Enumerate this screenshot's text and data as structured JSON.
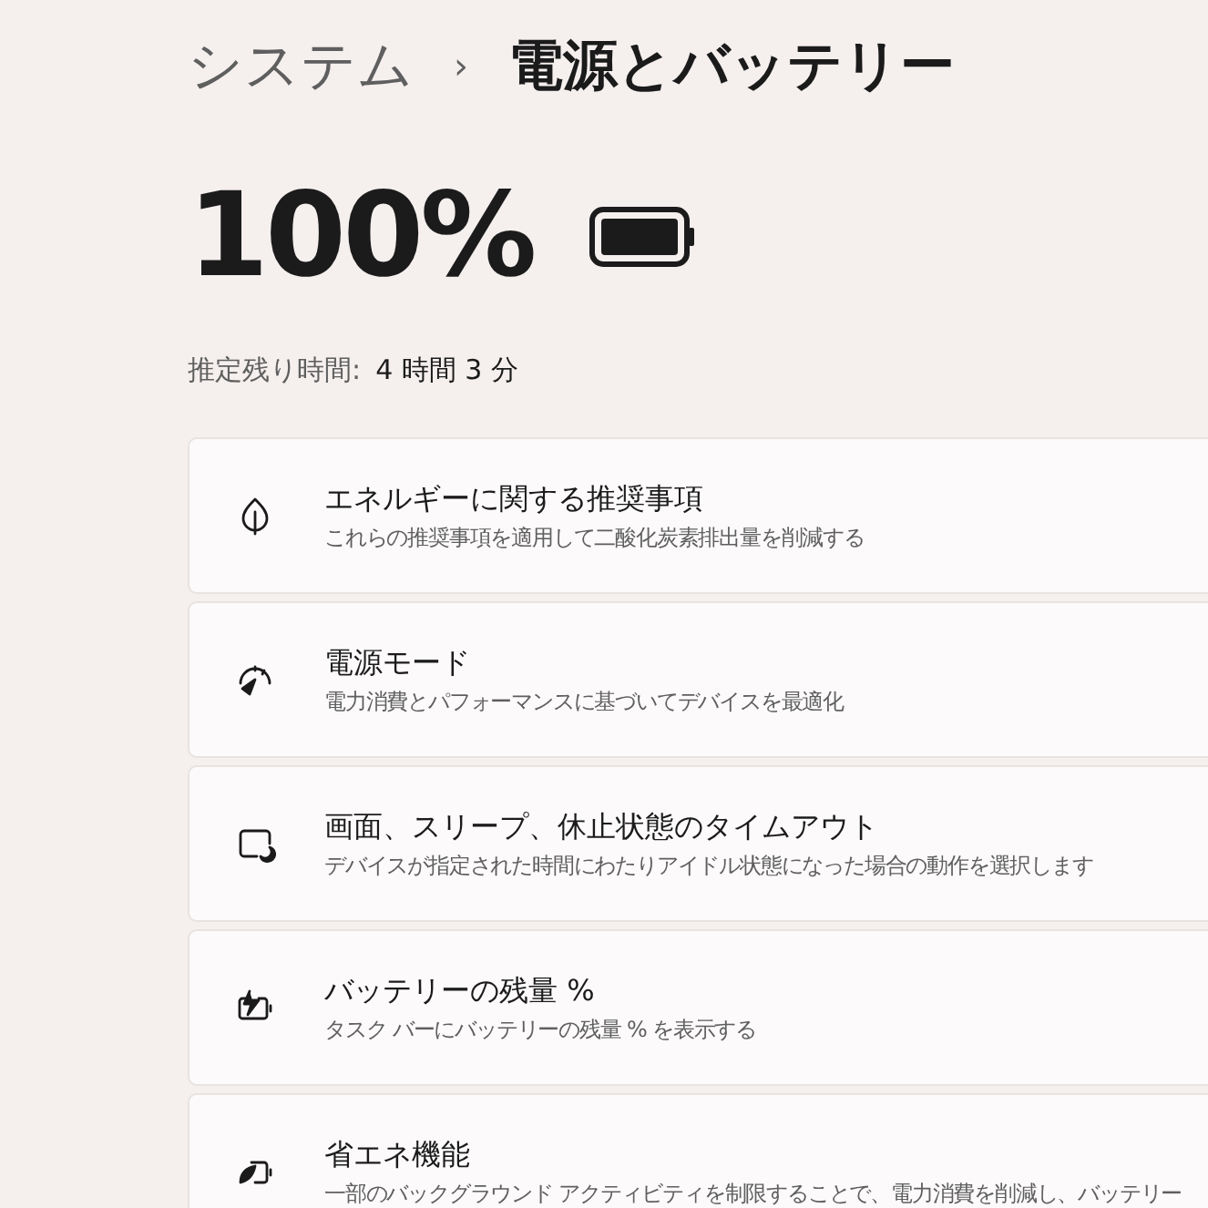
{
  "breadcrumb": {
    "parent": "システム",
    "separator": "›",
    "current": "電源とバッテリー"
  },
  "battery": {
    "percent": "100%",
    "level": 1
  },
  "estimate": {
    "label": "推定残り時間:",
    "value": "4 時間 3 分"
  },
  "settings": [
    {
      "kind": "leaf",
      "title": "エネルギーに関する推奨事項",
      "description": "これらの推奨事項を適用して二酸化炭素排出量を削減する"
    },
    {
      "kind": "gauge",
      "title": "電源モード",
      "description": "電力消費とパフォーマンスに基づいてデバイスを最適化"
    },
    {
      "kind": "sleep",
      "title": "画面、スリープ、休止状態のタイムアウト",
      "description": "デバイスが指定された時間にわたりアイドル状態になった場合の動作を選択します"
    },
    {
      "kind": "battery-charge",
      "title": "バッテリーの残量 %",
      "description": "タスク バーにバッテリーの残量 % を表示する"
    },
    {
      "kind": "battery-saver",
      "title": "省エネ機能",
      "description": "一部のバックグラウンド アクティビティを制限することで、電力消費を削減し、バッテリー"
    }
  ]
}
